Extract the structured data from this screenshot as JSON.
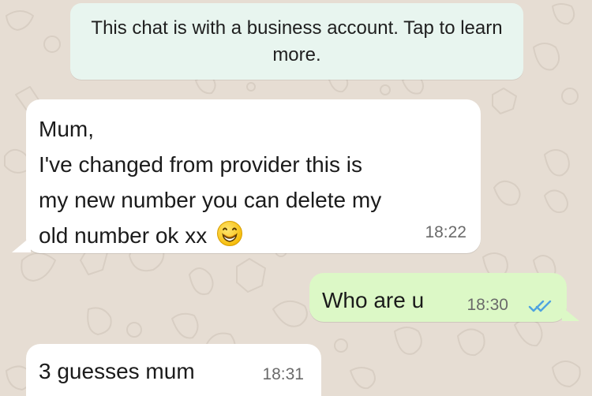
{
  "system_notice": {
    "text": "This chat is with a business account. Tap to\nlearn more."
  },
  "messages": [
    {
      "text": "Mum,\nI've changed from provider this is\nmy new number you can delete my\nold number ok xx",
      "time": "18:22",
      "emoji_icon": "grinning-face-with-smiling-eyes-icon"
    },
    {
      "text": "Who are u",
      "time": "18:30",
      "status_icon": "double-check-read-icon"
    },
    {
      "text": "3 guesses mum",
      "time": "18:31"
    }
  ],
  "colors": {
    "background": "#e6ddd3",
    "notice_background": "#e8f5ef",
    "incoming_bubble": "#ffffff",
    "outgoing_bubble": "#dcf8c6",
    "read_receipt": "#4fa3e0"
  }
}
